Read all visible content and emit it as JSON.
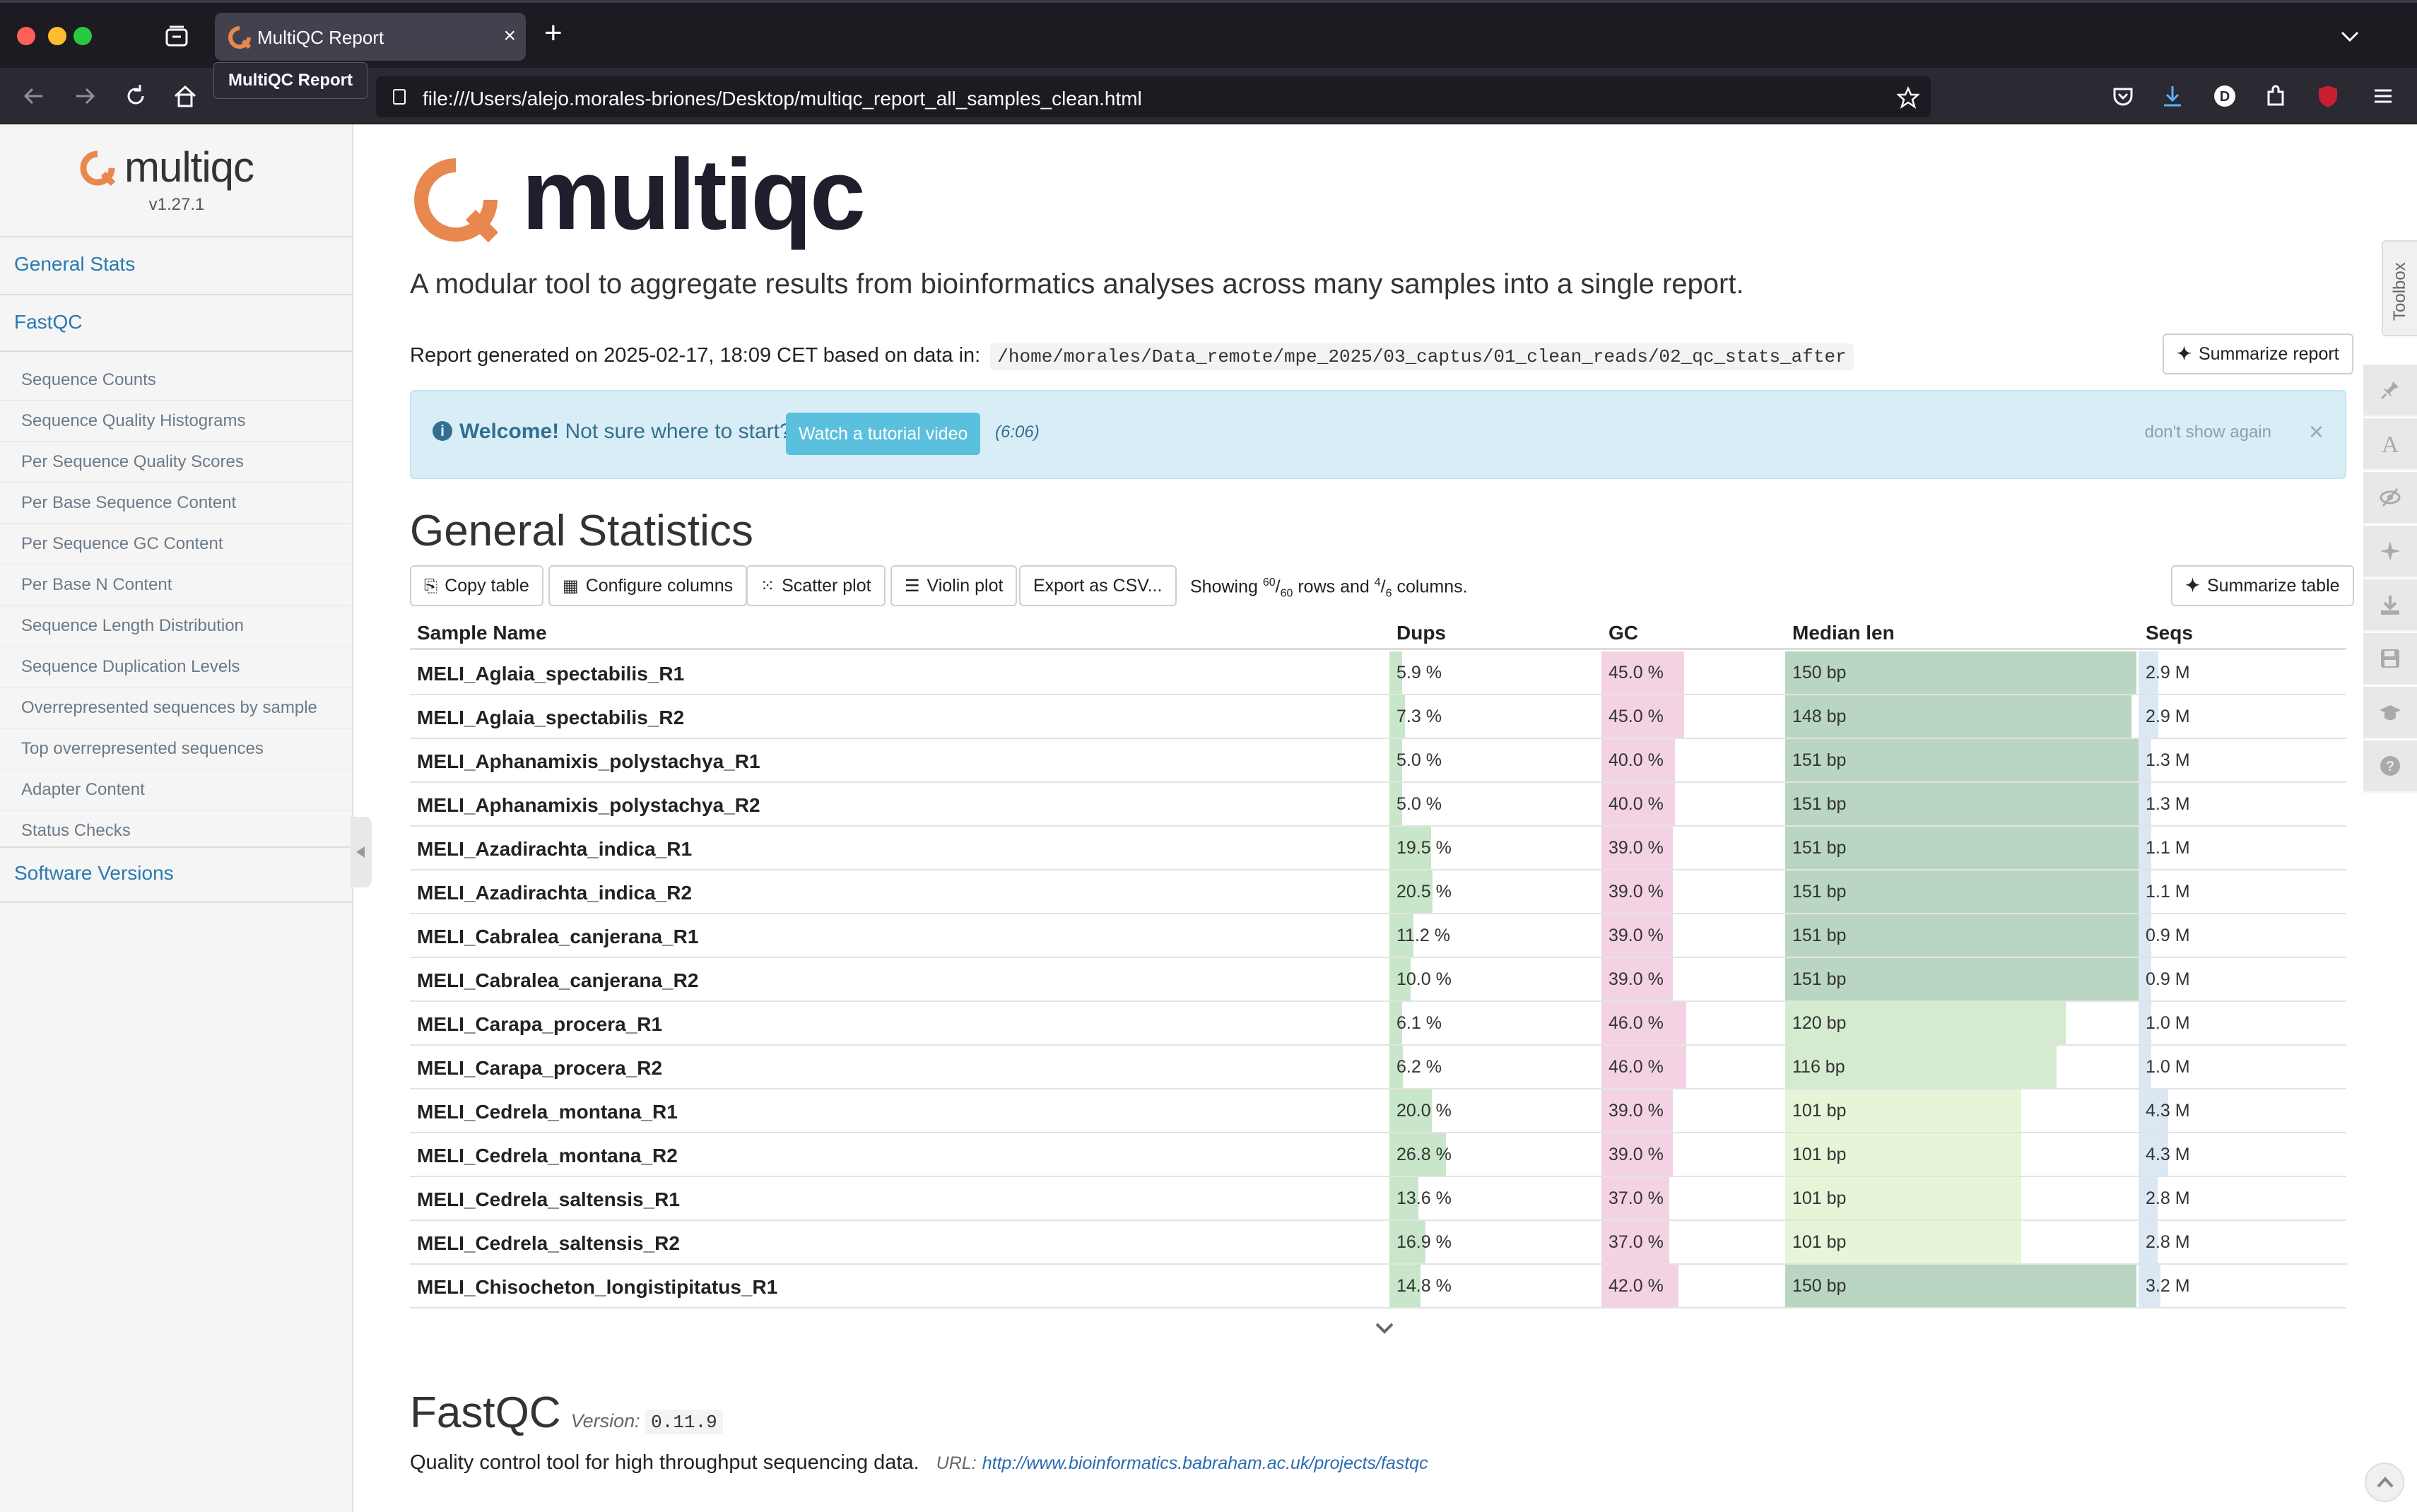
{
  "browser": {
    "tab_title": "MultiQC Report",
    "tooltip": "MultiQC Report",
    "url": "file:///Users/alejo.morales-briones/Desktop/multiqc_report_all_samples_clean.html"
  },
  "sidebar": {
    "logo_text": "multiqc",
    "version": "v1.27.1",
    "main_items": [
      "General Stats",
      "FastQC"
    ],
    "fastqc_items": [
      "Sequence Counts",
      "Sequence Quality Histograms",
      "Per Sequence Quality Scores",
      "Per Base Sequence Content",
      "Per Sequence GC Content",
      "Per Base N Content",
      "Sequence Length Distribution",
      "Sequence Duplication Levels",
      "Overrepresented sequences by sample",
      "Top overrepresented sequences",
      "Adapter Content",
      "Status Checks"
    ],
    "software_versions": "Software Versions"
  },
  "header": {
    "logo_text": "multiqc",
    "lead": "A modular tool to aggregate results from bioinformatics analyses across many samples into a single report.",
    "report_generated": "Report generated on 2025-02-17, 18:09 CET based on data in:",
    "report_path": "/home/morales/Data_remote/mpe_2025/03_captus/01_clean_reads/02_qc_stats_after",
    "summarize_report": "Summarize report"
  },
  "welcome": {
    "strong": "Welcome!",
    "text": "Not sure where to start?",
    "button": "Watch a tutorial video",
    "duration": "(6:06)",
    "dont_show": "don't show again",
    "close": "×"
  },
  "general_stats": {
    "title": "General Statistics",
    "buttons": {
      "copy": "Copy table",
      "configure": "Configure columns",
      "scatter": "Scatter plot",
      "violin": "Violin plot",
      "export": "Export as CSV...",
      "summarize": "Summarize table"
    },
    "showing_prefix": "Showing",
    "rows_shown": "60",
    "rows_total": "60",
    "rows_word": "rows and",
    "cols_shown": "4",
    "cols_total": "6",
    "cols_word": "columns.",
    "columns": [
      "Sample Name",
      "Dups",
      "GC",
      "Median len",
      "Seqs"
    ],
    "colors": {
      "dups": "#c8e6c9",
      "gc": "#f3d2e4",
      "len_high": "#b9d6c3",
      "len_mid": "#d5ebcf",
      "len_low": "#e6f4d8",
      "seqs": "#dbe8f3"
    },
    "rows": [
      {
        "sample": "MELI_Aglaia_spectabilis_R1",
        "dups": "5.9 %",
        "dups_v": 5.9,
        "gc": "45.0 %",
        "gc_v": 45.0,
        "len": "150 bp",
        "len_v": 150,
        "seqs": "2.9 M",
        "seqs_v": 2.9
      },
      {
        "sample": "MELI_Aglaia_spectabilis_R2",
        "dups": "7.3 %",
        "dups_v": 7.3,
        "gc": "45.0 %",
        "gc_v": 45.0,
        "len": "148 bp",
        "len_v": 148,
        "seqs": "2.9 M",
        "seqs_v": 2.9
      },
      {
        "sample": "MELI_Aphanamixis_polystachya_R1",
        "dups": "5.0 %",
        "dups_v": 5.0,
        "gc": "40.0 %",
        "gc_v": 40.0,
        "len": "151 bp",
        "len_v": 151,
        "seqs": "1.3 M",
        "seqs_v": 1.3
      },
      {
        "sample": "MELI_Aphanamixis_polystachya_R2",
        "dups": "5.0 %",
        "dups_v": 5.0,
        "gc": "40.0 %",
        "gc_v": 40.0,
        "len": "151 bp",
        "len_v": 151,
        "seqs": "1.3 M",
        "seqs_v": 1.3
      },
      {
        "sample": "MELI_Azadirachta_indica_R1",
        "dups": "19.5 %",
        "dups_v": 19.5,
        "gc": "39.0 %",
        "gc_v": 39.0,
        "len": "151 bp",
        "len_v": 151,
        "seqs": "1.1 M",
        "seqs_v": 1.1
      },
      {
        "sample": "MELI_Azadirachta_indica_R2",
        "dups": "20.5 %",
        "dups_v": 20.5,
        "gc": "39.0 %",
        "gc_v": 39.0,
        "len": "151 bp",
        "len_v": 151,
        "seqs": "1.1 M",
        "seqs_v": 1.1
      },
      {
        "sample": "MELI_Cabralea_canjerana_R1",
        "dups": "11.2 %",
        "dups_v": 11.2,
        "gc": "39.0 %",
        "gc_v": 39.0,
        "len": "151 bp",
        "len_v": 151,
        "seqs": "0.9 M",
        "seqs_v": 0.9
      },
      {
        "sample": "MELI_Cabralea_canjerana_R2",
        "dups": "10.0 %",
        "dups_v": 10.0,
        "gc": "39.0 %",
        "gc_v": 39.0,
        "len": "151 bp",
        "len_v": 151,
        "seqs": "0.9 M",
        "seqs_v": 0.9
      },
      {
        "sample": "MELI_Carapa_procera_R1",
        "dups": "6.1 %",
        "dups_v": 6.1,
        "gc": "46.0 %",
        "gc_v": 46.0,
        "len": "120 bp",
        "len_v": 120,
        "seqs": "1.0 M",
        "seqs_v": 1.0
      },
      {
        "sample": "MELI_Carapa_procera_R2",
        "dups": "6.2 %",
        "dups_v": 6.2,
        "gc": "46.0 %",
        "gc_v": 46.0,
        "len": "116 bp",
        "len_v": 116,
        "seqs": "1.0 M",
        "seqs_v": 1.0
      },
      {
        "sample": "MELI_Cedrela_montana_R1",
        "dups": "20.0 %",
        "dups_v": 20.0,
        "gc": "39.0 %",
        "gc_v": 39.0,
        "len": "101 bp",
        "len_v": 101,
        "seqs": "4.3 M",
        "seqs_v": 4.3
      },
      {
        "sample": "MELI_Cedrela_montana_R2",
        "dups": "26.8 %",
        "dups_v": 26.8,
        "gc": "39.0 %",
        "gc_v": 39.0,
        "len": "101 bp",
        "len_v": 101,
        "seqs": "4.3 M",
        "seqs_v": 4.3
      },
      {
        "sample": "MELI_Cedrela_saltensis_R1",
        "dups": "13.6 %",
        "dups_v": 13.6,
        "gc": "37.0 %",
        "gc_v": 37.0,
        "len": "101 bp",
        "len_v": 101,
        "seqs": "2.8 M",
        "seqs_v": 2.8
      },
      {
        "sample": "MELI_Cedrela_saltensis_R2",
        "dups": "16.9 %",
        "dups_v": 16.9,
        "gc": "37.0 %",
        "gc_v": 37.0,
        "len": "101 bp",
        "len_v": 101,
        "seqs": "2.8 M",
        "seqs_v": 2.8
      },
      {
        "sample": "MELI_Chisocheton_longistipitatus_R1",
        "dups": "14.8 %",
        "dups_v": 14.8,
        "gc": "42.0 %",
        "gc_v": 42.0,
        "len": "150 bp",
        "len_v": 150,
        "seqs": "3.2 M",
        "seqs_v": 3.2
      }
    ]
  },
  "fastqc": {
    "title": "FastQC",
    "version_label": "Version:",
    "version": "0.11.9",
    "description": "Quality control tool for high throughput sequencing data.",
    "url_label": "URL:",
    "url": "http://www.bioinformatics.babraham.ac.uk/projects/fastqc"
  },
  "toolbox": {
    "label": "Toolbox",
    "icons": [
      "pin-icon",
      "font-icon",
      "eye-slash-icon",
      "sparkle-icon",
      "download-icon",
      "save-icon",
      "graduation-cap-icon",
      "help-icon"
    ]
  }
}
